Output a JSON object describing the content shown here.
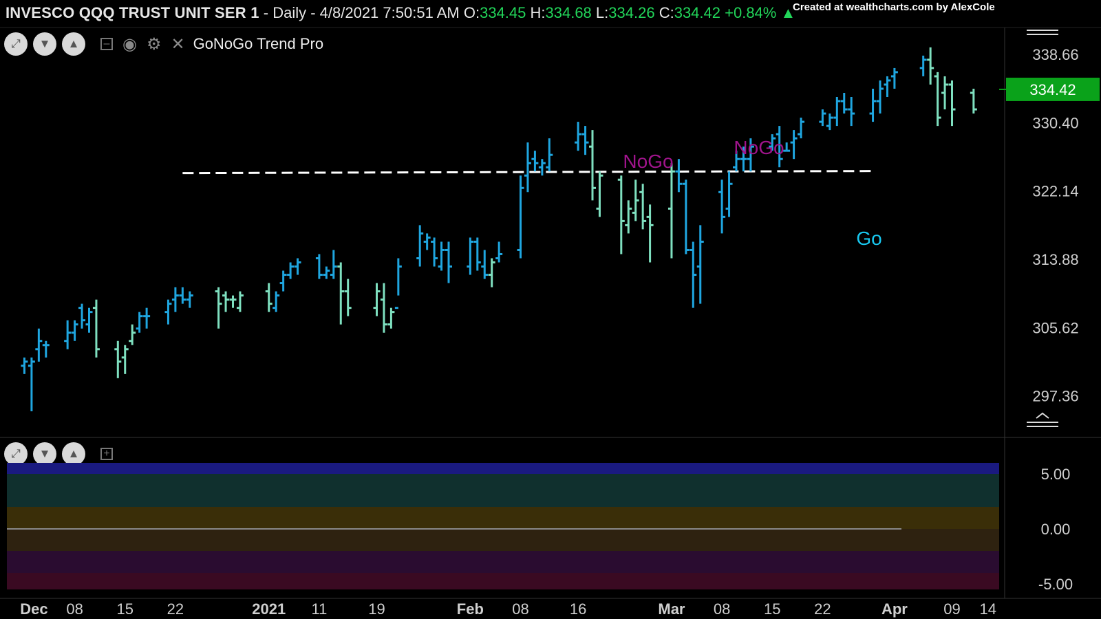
{
  "header": {
    "symbol": "INVESCO QQQ TRUST UNIT SER 1",
    "interval": " - Daily - ",
    "datetime": "4/8/2021 7:50:51 AM",
    "o_label": "O:",
    "o": "334.45",
    "h_label": "H:",
    "h": "334.68",
    "l_label": "L:",
    "l": "334.26",
    "c_label": "C:",
    "c": "334.42",
    "change": "+0.84%",
    "credit": "Created at wealthcharts.com by AlexCole"
  },
  "toolbar": {
    "indicator_name": "GoNoGo Trend Pro"
  },
  "colors": {
    "strong_go": "#1fa6e0",
    "weak_go": "#7fe0c0",
    "weak_nogo": "#e07a2a",
    "nogo": "#a0148c",
    "strong_nogo": "#f07ad8",
    "price_box": "#0aa21a",
    "osc_cyan": "#30f0f0",
    "osc_blue": "#1818ff"
  },
  "chart_data": [
    {
      "type": "ohlc",
      "title": "INVESCO QQQ TRUST UNIT SER 1",
      "y_ticks": [
        338.66,
        330.4,
        322.14,
        313.88,
        305.62,
        297.36
      ],
      "ylim": [
        293.5,
        341.9
      ],
      "last_price": 334.42,
      "x_labels": [
        "Dec",
        "08",
        "15",
        "22",
        "2021",
        "11",
        "19",
        "Feb",
        "08",
        "16",
        "Mar",
        "08",
        "15",
        "22",
        "Apr",
        "09",
        "14"
      ],
      "annotations": [
        {
          "text": "NoGo",
          "color": "#a0148c"
        },
        {
          "text": "NoGo",
          "color": "#a0148c"
        },
        {
          "text": "Go",
          "color": "#18c8f0"
        }
      ],
      "resistance_level": 324.3,
      "bars": [
        {
          "d": "12-01",
          "o": 301,
          "h": 302,
          "l": 300,
          "c": 301.5,
          "s": "G"
        },
        {
          "d": "12-02",
          "o": 301,
          "h": 302,
          "l": 295.5,
          "c": 301.5,
          "s": "G"
        },
        {
          "d": "12-03",
          "o": 303,
          "h": 305.5,
          "l": 301.5,
          "c": 304,
          "s": "G"
        },
        {
          "d": "12-04",
          "o": 303.5,
          "h": 304,
          "l": 302,
          "c": 303.5,
          "s": "G"
        },
        {
          "d": "12-07",
          "o": 304,
          "h": 306.5,
          "l": 303,
          "c": 305,
          "s": "G"
        },
        {
          "d": "12-08",
          "o": 305,
          "h": 306.5,
          "l": 304,
          "c": 306,
          "s": "G"
        },
        {
          "d": "12-09",
          "o": 308,
          "h": 308.5,
          "l": 305.5,
          "c": 306.5,
          "s": "G"
        },
        {
          "d": "12-10",
          "o": 306,
          "h": 308,
          "l": 305,
          "c": 307.5,
          "s": "G"
        },
        {
          "d": "12-11",
          "o": 308,
          "h": 309,
          "l": 302,
          "c": 303,
          "s": "W"
        },
        {
          "d": "12-14",
          "o": 303,
          "h": 304,
          "l": 299.5,
          "c": 301.5,
          "s": "W"
        },
        {
          "d": "12-15",
          "o": 302,
          "h": 303.5,
          "l": 300,
          "c": 303,
          "s": "W"
        },
        {
          "d": "12-16",
          "o": 304,
          "h": 306,
          "l": 303.5,
          "c": 305,
          "s": "W"
        },
        {
          "d": "12-17",
          "o": 305.5,
          "h": 307.5,
          "l": 305,
          "c": 307,
          "s": "G"
        },
        {
          "d": "12-18",
          "o": 307,
          "h": 308,
          "l": 305.5,
          "c": 307,
          "s": "G"
        },
        {
          "d": "12-21",
          "o": 307.5,
          "h": 309,
          "l": 306,
          "c": 308.5,
          "s": "G"
        },
        {
          "d": "12-22",
          "o": 309,
          "h": 310.5,
          "l": 307.5,
          "c": 309.5,
          "s": "G"
        },
        {
          "d": "12-23",
          "o": 309.5,
          "h": 310.5,
          "l": 308.5,
          "c": 309,
          "s": "G"
        },
        {
          "d": "12-24",
          "o": 309,
          "h": 310,
          "l": 308,
          "c": 309.5,
          "s": "G"
        },
        {
          "d": "12-28",
          "o": 310,
          "h": 310.5,
          "l": 305.5,
          "c": 308.5,
          "s": "W"
        },
        {
          "d": "12-29",
          "o": 309.5,
          "h": 310,
          "l": 307.5,
          "c": 309,
          "s": "W"
        },
        {
          "d": "12-30",
          "o": 309,
          "h": 309.5,
          "l": 308,
          "c": 309,
          "s": "W"
        },
        {
          "d": "12-31",
          "o": 308,
          "h": 310,
          "l": 307.5,
          "c": 309.5,
          "s": "W"
        },
        {
          "d": "01-04",
          "o": 310,
          "h": 311,
          "l": 307.5,
          "c": 308.5,
          "s": "W"
        },
        {
          "d": "01-05",
          "o": 308,
          "h": 310,
          "l": 307.5,
          "c": 309.5,
          "s": "G"
        },
        {
          "d": "01-06",
          "o": 311,
          "h": 312.5,
          "l": 310,
          "c": 312,
          "s": "G"
        },
        {
          "d": "01-07",
          "o": 312,
          "h": 313.5,
          "l": 311.5,
          "c": 313,
          "s": "G"
        },
        {
          "d": "01-08",
          "o": 313,
          "h": 314,
          "l": 312,
          "c": 313.5,
          "s": "G"
        },
        {
          "d": "01-11",
          "o": 314,
          "h": 314.5,
          "l": 311.5,
          "c": 312,
          "s": "G"
        },
        {
          "d": "01-12",
          "o": 312,
          "h": 313,
          "l": 311.5,
          "c": 312.5,
          "s": "G"
        },
        {
          "d": "01-13",
          "o": 312,
          "h": 315,
          "l": 311.5,
          "c": 313,
          "s": "G"
        },
        {
          "d": "01-14",
          "o": 313,
          "h": 313.5,
          "l": 306,
          "c": 310,
          "s": "W"
        },
        {
          "d": "01-15",
          "o": 310,
          "h": 311.5,
          "l": 307,
          "c": 308,
          "s": "W"
        },
        {
          "d": "01-19",
          "o": 308,
          "h": 311,
          "l": 307,
          "c": 310,
          "s": "W"
        },
        {
          "d": "01-20",
          "o": 309,
          "h": 311,
          "l": 305,
          "c": 306,
          "s": "W"
        },
        {
          "d": "01-21",
          "o": 306,
          "h": 308,
          "l": 305.5,
          "c": 307.5,
          "s": "W"
        },
        {
          "d": "01-22",
          "o": 308,
          "h": 314,
          "l": 309.5,
          "c": 313,
          "s": "G"
        },
        {
          "d": "01-25",
          "o": 314,
          "h": 318,
          "l": 313,
          "c": 317,
          "s": "G"
        },
        {
          "d": "01-26",
          "o": 316,
          "h": 317,
          "l": 315,
          "c": 316.5,
          "s": "G"
        },
        {
          "d": "01-27",
          "o": 316,
          "h": 316.5,
          "l": 313,
          "c": 314,
          "s": "G"
        },
        {
          "d": "01-28",
          "o": 313,
          "h": 316,
          "l": 312.5,
          "c": 315,
          "s": "G"
        },
        {
          "d": "01-29",
          "o": 315,
          "h": 316,
          "l": 311,
          "c": 313,
          "s": "G"
        },
        {
          "d": "02-01",
          "o": 313,
          "h": 316.5,
          "l": 312,
          "c": 316,
          "s": "G"
        },
        {
          "d": "02-02",
          "o": 316,
          "h": 316.5,
          "l": 312.5,
          "c": 313.5,
          "s": "G"
        },
        {
          "d": "02-03",
          "o": 313,
          "h": 315,
          "l": 311.5,
          "c": 312,
          "s": "G"
        },
        {
          "d": "02-04",
          "o": 312,
          "h": 314,
          "l": 310.5,
          "c": 313.5,
          "s": "W"
        },
        {
          "d": "02-05",
          "o": 314,
          "h": 316,
          "l": 313.5,
          "c": 314.5,
          "s": "G"
        },
        {
          "d": "02-08",
          "o": 315,
          "h": 324,
          "l": 314,
          "c": 322.5,
          "s": "G"
        },
        {
          "d": "02-09",
          "o": 324,
          "h": 328,
          "l": 322,
          "c": 325.5,
          "s": "G"
        },
        {
          "d": "02-10",
          "o": 326,
          "h": 327,
          "l": 324.5,
          "c": 325.5,
          "s": "G"
        },
        {
          "d": "02-11",
          "o": 325,
          "h": 326,
          "l": 324,
          "c": 325.5,
          "s": "G"
        },
        {
          "d": "02-12",
          "o": 325,
          "h": 328.5,
          "l": 324.5,
          "c": 326.5,
          "s": "G"
        },
        {
          "d": "02-16",
          "o": 328,
          "h": 330.5,
          "l": 327,
          "c": 329,
          "s": "G"
        },
        {
          "d": "02-17",
          "o": 329,
          "h": 330,
          "l": 326.5,
          "c": 328,
          "s": "G"
        },
        {
          "d": "02-18",
          "o": 327.5,
          "h": 329.5,
          "l": 321,
          "c": 322.5,
          "s": "W"
        },
        {
          "d": "02-19",
          "o": 320,
          "h": 324.5,
          "l": 319,
          "c": 324,
          "s": "W"
        },
        {
          "d": "02-22",
          "o": 323.5,
          "h": 324,
          "l": 314.5,
          "c": 318.5,
          "s": "W"
        },
        {
          "d": "02-23",
          "o": 318,
          "h": 321,
          "l": 317,
          "c": 320,
          "s": "W"
        },
        {
          "d": "02-24",
          "o": 319.5,
          "h": 323.5,
          "l": 318.5,
          "c": 321,
          "s": "W"
        },
        {
          "d": "02-25",
          "o": 322,
          "h": 323,
          "l": 317.5,
          "c": 318.5,
          "s": "W"
        },
        {
          "d": "02-26",
          "o": 319,
          "h": 320.5,
          "l": 313.5,
          "c": 318,
          "s": "W"
        },
        {
          "d": "03-01",
          "o": 320,
          "h": 325.5,
          "l": 314,
          "c": 324.5,
          "s": "W"
        },
        {
          "d": "03-02",
          "o": 324.5,
          "h": 326,
          "l": 322,
          "c": 323,
          "s": "G"
        },
        {
          "d": "03-03",
          "o": 323,
          "h": 323.5,
          "l": 314.5,
          "c": 315,
          "s": "G"
        },
        {
          "d": "03-04",
          "o": 315,
          "h": 316,
          "l": 308,
          "c": 312,
          "s": "G"
        },
        {
          "d": "03-05",
          "o": 313,
          "h": 318,
          "l": 308.5,
          "c": 316,
          "s": "G"
        },
        {
          "d": "03-08",
          "o": 322,
          "h": 323.5,
          "l": 317,
          "c": 319,
          "s": "G"
        },
        {
          "d": "03-09",
          "o": 320,
          "h": 324.5,
          "l": 319,
          "c": 323,
          "s": "G"
        },
        {
          "d": "03-10",
          "o": 325,
          "h": 327,
          "l": 324.5,
          "c": 326,
          "s": "G"
        },
        {
          "d": "03-11",
          "o": 326,
          "h": 327.5,
          "l": 324.5,
          "c": 326,
          "s": "G"
        },
        {
          "d": "03-12",
          "o": 326,
          "h": 328.5,
          "l": 324.5,
          "c": 327.5,
          "s": "G"
        },
        {
          "d": "03-15",
          "o": 327.5,
          "h": 329,
          "l": 327,
          "c": 328.5,
          "s": "G"
        },
        {
          "d": "03-16",
          "o": 329,
          "h": 330,
          "l": 325,
          "c": 326,
          "s": "G"
        },
        {
          "d": "03-17",
          "o": 327,
          "h": 328,
          "l": 327,
          "c": 327,
          "s": "G"
        },
        {
          "d": "03-18",
          "o": 328,
          "h": 329.5,
          "l": 326,
          "c": 328.5,
          "s": "G"
        },
        {
          "d": "03-19",
          "o": 329,
          "h": 331,
          "l": 328.5,
          "c": 330.5,
          "s": "G"
        },
        {
          "d": "03-22",
          "o": 330.5,
          "h": 332,
          "l": 330,
          "c": 331.5,
          "s": "G"
        },
        {
          "d": "03-23",
          "o": 330,
          "h": 331.5,
          "l": 329.5,
          "c": 331,
          "s": "G"
        },
        {
          "d": "03-24",
          "o": 331,
          "h": 333.5,
          "l": 330,
          "c": 333,
          "s": "G"
        },
        {
          "d": "03-25",
          "o": 333,
          "h": 334,
          "l": 331.5,
          "c": 332,
          "s": "G"
        },
        {
          "d": "03-26",
          "o": 332,
          "h": 333.5,
          "l": 330,
          "c": 331.5,
          "s": "G"
        },
        {
          "d": "03-29",
          "o": 331.5,
          "h": 334.5,
          "l": 330.5,
          "c": 333,
          "s": "G"
        },
        {
          "d": "03-30",
          "o": 333,
          "h": 335.5,
          "l": 331.5,
          "c": 334.5,
          "s": "G"
        },
        {
          "d": "03-31",
          "o": 335,
          "h": 336,
          "l": 333.5,
          "c": 335.5,
          "s": "G"
        },
        {
          "d": "04-01",
          "o": 336,
          "h": 337,
          "l": 334.5,
          "c": 336.5,
          "s": "G"
        },
        {
          "d": "04-05",
          "o": 337,
          "h": 338.5,
          "l": 336,
          "c": 338,
          "s": "G"
        },
        {
          "d": "04-06",
          "o": 338,
          "h": 339.5,
          "l": 335,
          "c": 337,
          "s": "W"
        },
        {
          "d": "04-07",
          "o": 336,
          "h": 336.5,
          "l": 330,
          "c": 331,
          "s": "W"
        },
        {
          "d": "04-08",
          "o": 334,
          "h": 336,
          "l": 332,
          "c": 335,
          "s": "W"
        },
        {
          "d": "04-09",
          "o": 335,
          "h": 335.5,
          "l": 330,
          "c": 332,
          "s": "W"
        },
        {
          "d": "04-12",
          "o": 334,
          "h": 334.5,
          "l": 331.5,
          "c": 332,
          "s": "W"
        }
      ]
    },
    {
      "type": "line",
      "title": "GoNoGo Oscillator",
      "y_ticks": [
        5.0,
        0.0,
        -5.0
      ],
      "ylim": [
        -5.5,
        6.0
      ]
    }
  ]
}
